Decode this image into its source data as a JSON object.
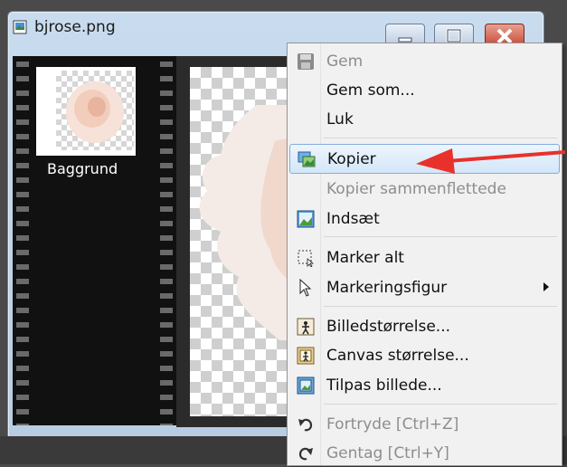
{
  "window": {
    "title": "bjrose.png"
  },
  "layers": {
    "items": [
      {
        "name": "Baggrund"
      }
    ]
  },
  "menu": {
    "items": [
      {
        "label": "Gem",
        "disabled": true,
        "icon": "floppy-icon"
      },
      {
        "label": "Gem som...",
        "disabled": false
      },
      {
        "label": "Luk",
        "disabled": false
      },
      {
        "label": "Kopier",
        "disabled": false,
        "highlighted": true,
        "icon": "copy-image-icon"
      },
      {
        "label": "Kopier sammenflettede",
        "disabled": true
      },
      {
        "label": "Indsæt",
        "disabled": false,
        "icon": "paste-image-icon"
      },
      {
        "label": "Marker alt",
        "disabled": false,
        "icon": "select-all-icon"
      },
      {
        "label": "Markeringsfigur",
        "disabled": false,
        "icon": "cursor-icon",
        "submenu": true
      },
      {
        "label": "Billedstørrelse...",
        "disabled": false,
        "icon": "image-size-icon"
      },
      {
        "label": "Canvas størrelse...",
        "disabled": false,
        "icon": "canvas-size-icon"
      },
      {
        "label": "Tilpas billede...",
        "disabled": false,
        "icon": "fit-image-icon"
      },
      {
        "label": "Fortryde [Ctrl+Z]",
        "disabled": true,
        "icon": "undo-icon"
      },
      {
        "label": "Gentag [Ctrl+Y]",
        "disabled": true,
        "icon": "redo-icon"
      }
    ]
  },
  "annotation": {
    "color": "#e8312a"
  },
  "colors": {
    "highlight": "#d3e6f8",
    "disabled_text": "#8d8d8d"
  }
}
